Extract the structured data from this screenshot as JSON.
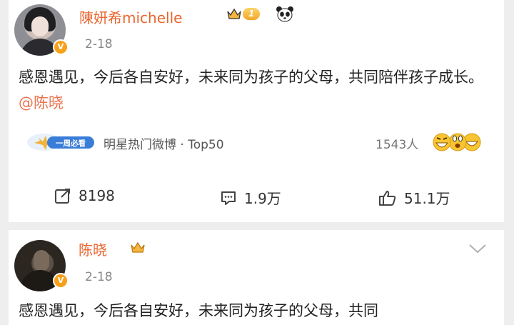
{
  "colors": {
    "username": "#e8652f",
    "mention": "#eb7350",
    "badge": "#f7a11b",
    "text": "#222222",
    "meta": "#888888"
  },
  "post1": {
    "username": "陳妍希michelle",
    "level": "1",
    "date": "2-18",
    "text_main": "感恩遇见，今后各自安好，未来同为孩子的父母，共同陪伴孩子成长。",
    "mention": "@陈晓",
    "topic_badge_text": "一周必看",
    "topic": "明星热门微博 · Top50",
    "reaction_count": "1543人",
    "reposts": "8198",
    "comments": "1.9万",
    "likes": "51.1万"
  },
  "post2": {
    "username": "陈晓",
    "date": "2-18",
    "text": "感恩遇见，今后各自安好，未来同为孩子的父母，共同"
  },
  "icons": [
    "avatar",
    "verified-badge-icon",
    "crown-icon",
    "panda-icon",
    "repost-icon",
    "comment-icon",
    "like-icon",
    "emoji-icon",
    "chevron-down-icon"
  ]
}
